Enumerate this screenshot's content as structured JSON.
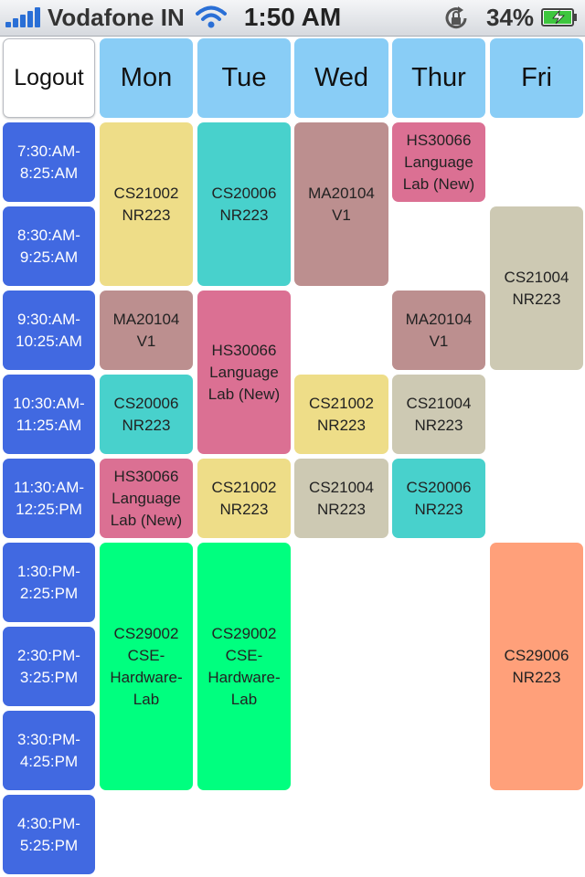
{
  "status_bar": {
    "carrier": "Vodafone IN",
    "time": "1:50 AM",
    "battery": "34%"
  },
  "header": {
    "logout_label": "Logout",
    "days": [
      "Mon",
      "Tue",
      "Wed",
      "Thur",
      "Fri"
    ]
  },
  "slots": [
    "7:30:AM-\n8:25:AM",
    "8:30:AM-\n9:25:AM",
    "9:30:AM-\n10:25:AM",
    "10:30:AM-\n11:25:AM",
    "11:30:AM-\n12:25:PM",
    "1:30:PM-\n2:25:PM",
    "2:30:PM-\n3:25:PM",
    "3:30:PM-\n4:25:PM",
    "4:30:PM-\n5:25:PM"
  ],
  "classes": [
    {
      "day": "Mon",
      "text": "CS21002\nNR223",
      "color": "#eedd88"
    },
    {
      "day": "Mon",
      "text": "MA20104\nV1",
      "color": "#bc8f8f"
    },
    {
      "day": "Mon",
      "text": "CS20006\nNR223",
      "color": "#48d1cc"
    },
    {
      "day": "Mon",
      "text": "HS30066\nLanguage\nLab (New)",
      "color": "#db7093"
    },
    {
      "day": "Mon",
      "text": "CS29002\nCSE-\nHardware-\nLab",
      "color": "#00ff7f"
    },
    {
      "day": "Tue",
      "text": "CS20006\nNR223",
      "color": "#48d1cc"
    },
    {
      "day": "Tue",
      "text": "HS30066\nLanguage\nLab (New)",
      "color": "#db7093"
    },
    {
      "day": "Tue",
      "text": "CS21002\nNR223",
      "color": "#eedd88"
    },
    {
      "day": "Tue",
      "text": "CS29002\nCSE-\nHardware-\nLab",
      "color": "#00ff7f"
    },
    {
      "day": "Wed",
      "text": "MA20104\nV1",
      "color": "#bc8f8f"
    },
    {
      "day": "Wed",
      "text": "CS21002\nNR223",
      "color": "#eedd88"
    },
    {
      "day": "Wed",
      "text": "CS21004\nNR223",
      "color": "#cdc9b3"
    },
    {
      "day": "Thur",
      "text": "HS30066\nLanguage\nLab (New)",
      "color": "#db7093"
    },
    {
      "day": "Thur",
      "text": "MA20104\nV1",
      "color": "#bc8f8f"
    },
    {
      "day": "Thur",
      "text": "CS21004\nNR223",
      "color": "#cdc9b3"
    },
    {
      "day": "Thur",
      "text": "CS20006\nNR223",
      "color": "#48d1cc"
    },
    {
      "day": "Fri",
      "text": "CS21004\nNR223",
      "color": "#cdc9b3"
    },
    {
      "day": "Fri",
      "text": "CS29006\nNR223",
      "color": "#ffa07a"
    }
  ]
}
